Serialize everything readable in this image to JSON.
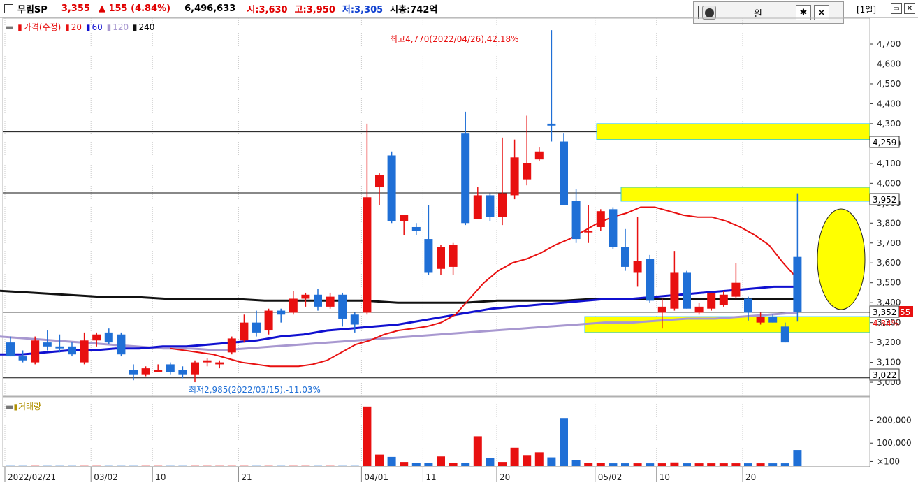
{
  "header": {
    "name": "무림SP",
    "price": "3,355",
    "change": "▲ 155 (4.84%)",
    "volume": "6,496,633",
    "open": "시:3,630",
    "high": "고:3,950",
    "low": "저:3,305",
    "mcap": "시총:742억"
  },
  "toolbar": {
    "currency": "원",
    "settings_icon": "gear-icon",
    "close_icon": "close-icon",
    "period": "[1일]"
  },
  "legend": {
    "price": "가격(수정)",
    "ma20": "20",
    "ma60": "60",
    "ma120": "120",
    "ma240": "240"
  },
  "volume_legend": "거래량",
  "annotations": {
    "high": "최고4,770(2022/04/26),42.18%",
    "low": "최저2,985(2022/03/15),-11.03%"
  },
  "price_labels": {
    "level1": "4,259",
    "level2": "3,952",
    "current": "3,352",
    "current_suffix": "55",
    "change_pct": "4.84%",
    "level3": "3,022"
  },
  "colors": {
    "up": "#e81010",
    "down": "#1f6fd6",
    "ma20": "#e81010",
    "ma60": "#1010d0",
    "ma120": "#a898d0",
    "ma240": "#111111",
    "highlight": "#ffff00"
  },
  "chart_data": {
    "type": "candlestick",
    "y_ticks": [
      "3,000",
      "3,100",
      "3,200",
      "3,300",
      "3,400",
      "3,500",
      "3,600",
      "3,700",
      "3,800",
      "3,900",
      "4,000",
      "4,100",
      "4,200",
      "4,300",
      "4,400",
      "4,500",
      "4,600",
      "4,700"
    ],
    "volume_ticks": [
      "200,000",
      "100,000",
      "×100"
    ],
    "x_ticks": [
      "2022/02/21",
      "03/02",
      "10",
      "21",
      "04/01",
      "11",
      "20",
      "05/02",
      "10",
      "20"
    ],
    "ylim": [
      2930,
      4830
    ],
    "candles": [
      {
        "o": 3200,
        "h": 3230,
        "l": 3130,
        "c": 3130
      },
      {
        "o": 3130,
        "h": 3160,
        "l": 3100,
        "c": 3110
      },
      {
        "o": 3100,
        "h": 3230,
        "l": 3090,
        "c": 3210
      },
      {
        "o": 3200,
        "h": 3260,
        "l": 3160,
        "c": 3180
      },
      {
        "o": 3180,
        "h": 3240,
        "l": 3150,
        "c": 3170
      },
      {
        "o": 3180,
        "h": 3200,
        "l": 3130,
        "c": 3140
      },
      {
        "o": 3100,
        "h": 3250,
        "l": 3090,
        "c": 3210
      },
      {
        "o": 3210,
        "h": 3250,
        "l": 3180,
        "c": 3240
      },
      {
        "o": 3250,
        "h": 3270,
        "l": 3190,
        "c": 3200
      },
      {
        "o": 3240,
        "h": 3250,
        "l": 3130,
        "c": 3140
      },
      {
        "o": 3060,
        "h": 3090,
        "l": 3010,
        "c": 3040
      },
      {
        "o": 3040,
        "h": 3080,
        "l": 3030,
        "c": 3070
      },
      {
        "o": 3060,
        "h": 3090,
        "l": 3050,
        "c": 3060
      },
      {
        "o": 3090,
        "h": 3100,
        "l": 3040,
        "c": 3050
      },
      {
        "o": 3060,
        "h": 3080,
        "l": 3020,
        "c": 3040
      },
      {
        "o": 3040,
        "h": 3110,
        "l": 3000,
        "c": 3100
      },
      {
        "o": 3100,
        "h": 3120,
        "l": 3080,
        "c": 3110
      },
      {
        "o": 3090,
        "h": 3110,
        "l": 3070,
        "c": 3100
      },
      {
        "o": 3150,
        "h": 3230,
        "l": 3140,
        "c": 3220
      },
      {
        "o": 3210,
        "h": 3340,
        "l": 3200,
        "c": 3300
      },
      {
        "o": 3300,
        "h": 3360,
        "l": 3230,
        "c": 3250
      },
      {
        "o": 3260,
        "h": 3370,
        "l": 3240,
        "c": 3360
      },
      {
        "o": 3360,
        "h": 3370,
        "l": 3300,
        "c": 3340
      },
      {
        "o": 3350,
        "h": 3460,
        "l": 3340,
        "c": 3420
      },
      {
        "o": 3420,
        "h": 3450,
        "l": 3380,
        "c": 3440
      },
      {
        "o": 3440,
        "h": 3470,
        "l": 3360,
        "c": 3380
      },
      {
        "o": 3380,
        "h": 3450,
        "l": 3370,
        "c": 3430
      },
      {
        "o": 3440,
        "h": 3450,
        "l": 3280,
        "c": 3320
      },
      {
        "o": 3340,
        "h": 3350,
        "l": 3250,
        "c": 3290
      },
      {
        "o": 3350,
        "h": 4300,
        "l": 3340,
        "c": 3930
      },
      {
        "o": 3980,
        "h": 4050,
        "l": 3890,
        "c": 4040
      },
      {
        "o": 4140,
        "h": 4160,
        "l": 3800,
        "c": 3810
      },
      {
        "o": 3810,
        "h": 3840,
        "l": 3740,
        "c": 3840
      },
      {
        "o": 3780,
        "h": 3800,
        "l": 3740,
        "c": 3760
      },
      {
        "o": 3720,
        "h": 3890,
        "l": 3540,
        "c": 3550
      },
      {
        "o": 3570,
        "h": 3690,
        "l": 3540,
        "c": 3680
      },
      {
        "o": 3580,
        "h": 3700,
        "l": 3540,
        "c": 3690
      },
      {
        "o": 4250,
        "h": 4360,
        "l": 3790,
        "c": 3800
      },
      {
        "o": 3820,
        "h": 3980,
        "l": 3820,
        "c": 3940
      },
      {
        "o": 3940,
        "h": 3950,
        "l": 3810,
        "c": 3830
      },
      {
        "o": 3830,
        "h": 4230,
        "l": 3790,
        "c": 3950
      },
      {
        "o": 3940,
        "h": 4220,
        "l": 3920,
        "c": 4130
      },
      {
        "o": 4020,
        "h": 4340,
        "l": 3990,
        "c": 4100
      },
      {
        "o": 4120,
        "h": 4180,
        "l": 4110,
        "c": 4160
      },
      {
        "o": 4300,
        "h": 4770,
        "l": 4210,
        "c": 4290
      },
      {
        "o": 4210,
        "h": 4250,
        "l": 3890,
        "c": 3890
      },
      {
        "o": 3910,
        "h": 3970,
        "l": 3700,
        "c": 3720
      },
      {
        "o": 3760,
        "h": 3890,
        "l": 3700,
        "c": 3760
      },
      {
        "o": 3780,
        "h": 3870,
        "l": 3760,
        "c": 3860
      },
      {
        "o": 3870,
        "h": 3880,
        "l": 3670,
        "c": 3680
      },
      {
        "o": 3680,
        "h": 3770,
        "l": 3560,
        "c": 3580
      },
      {
        "o": 3550,
        "h": 3830,
        "l": 3480,
        "c": 3610
      },
      {
        "o": 3620,
        "h": 3640,
        "l": 3400,
        "c": 3410
      },
      {
        "o": 3350,
        "h": 3420,
        "l": 3270,
        "c": 3380
      },
      {
        "o": 3370,
        "h": 3660,
        "l": 3360,
        "c": 3550
      },
      {
        "o": 3550,
        "h": 3560,
        "l": 3370,
        "c": 3370
      },
      {
        "o": 3350,
        "h": 3400,
        "l": 3340,
        "c": 3380
      },
      {
        "o": 3370,
        "h": 3450,
        "l": 3360,
        "c": 3450
      },
      {
        "o": 3390,
        "h": 3460,
        "l": 3380,
        "c": 3440
      },
      {
        "o": 3430,
        "h": 3600,
        "l": 3420,
        "c": 3500
      },
      {
        "o": 3420,
        "h": 3430,
        "l": 3310,
        "c": 3350
      },
      {
        "o": 3300,
        "h": 3350,
        "l": 3290,
        "c": 3330
      },
      {
        "o": 3330,
        "h": 3340,
        "l": 3300,
        "c": 3300
      },
      {
        "o": 3280,
        "h": 3300,
        "l": 3200,
        "c": 3200
      },
      {
        "o": 3630,
        "h": 3950,
        "l": 3305,
        "c": 3355
      }
    ],
    "ma20": [
      3170,
      3160,
      3150,
      3140,
      3120,
      3100,
      3090,
      3080,
      3080,
      3080,
      3090,
      3110,
      3150,
      3190,
      3210,
      3240,
      3260,
      3270,
      3280,
      3300,
      3340,
      3420,
      3500,
      3560,
      3600,
      3620,
      3650,
      3690,
      3720,
      3760,
      3800,
      3830,
      3850,
      3880,
      3880,
      3860,
      3840,
      3830,
      3830,
      3810,
      3780,
      3740,
      3690,
      3600,
      3520
    ],
    "ma60": [
      3140,
      3140,
      3150,
      3160,
      3160,
      3170,
      3170,
      3180,
      3180,
      3190,
      3200,
      3210,
      3230,
      3240,
      3260,
      3270,
      3280,
      3290,
      3310,
      3330,
      3350,
      3370,
      3380,
      3390,
      3400,
      3410,
      3420,
      3420,
      3430,
      3440,
      3450,
      3460,
      3470,
      3480,
      3480
    ],
    "ma120": [
      3230,
      3220,
      3210,
      3200,
      3190,
      3180,
      3170,
      3170,
      3160,
      3170,
      3180,
      3190,
      3200,
      3210,
      3220,
      3230,
      3240,
      3250,
      3260,
      3270,
      3280,
      3290,
      3300,
      3300,
      3310,
      3320,
      3320,
      3330,
      3340,
      3350
    ],
    "ma240": [
      3460,
      3450,
      3440,
      3430,
      3430,
      3420,
      3420,
      3420,
      3410,
      3410,
      3410,
      3410,
      3400,
      3400,
      3400,
      3410,
      3410,
      3410,
      3420,
      3420,
      3420,
      3420,
      3420,
      3420,
      3420
    ],
    "volumes": [
      8,
      8,
      8,
      8,
      8,
      8,
      8,
      8,
      8,
      8,
      8,
      8,
      8,
      8,
      8,
      8,
      8,
      8,
      8,
      8,
      8,
      8,
      8,
      8,
      8,
      8,
      8,
      8,
      8,
      2600,
      500,
      400,
      180,
      150,
      150,
      420,
      150,
      150,
      1300,
      350,
      180,
      800,
      480,
      600,
      380,
      2100,
      250,
      150,
      150,
      120,
      120,
      120,
      120,
      120,
      160,
      120,
      120,
      120,
      120,
      120,
      120,
      120,
      120,
      120,
      700
    ]
  }
}
